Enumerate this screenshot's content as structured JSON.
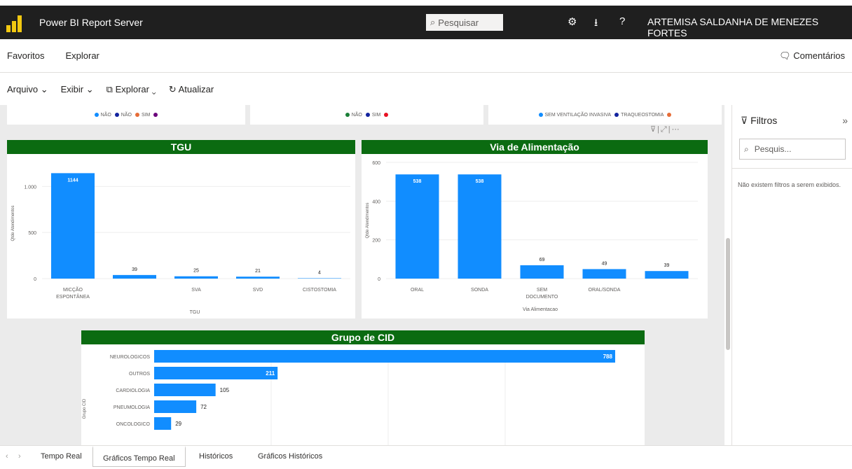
{
  "topbar": {
    "title": "Power BI Report Server",
    "search_placeholder": "Pesquisar",
    "settings_icon": "gear-icon",
    "download_icon": "download-icon",
    "help_label": "?",
    "user": "ARTEMISA SALDANHA DE MENEZES FORTES"
  },
  "menu": {
    "favorites": "Favoritos",
    "explore": "Explorar",
    "comments": "Comentários"
  },
  "toolbar": {
    "file": "Arquivo",
    "view": "Exibir",
    "explore": "Explorar",
    "refresh": "Atualizar"
  },
  "legends": [
    {
      "items": [
        {
          "label": "NÃO",
          "color": "#118dff"
        },
        {
          "label": "NÃO",
          "color": "#12239e"
        },
        {
          "label": "SIM",
          "color": "#e66c37"
        },
        {
          "label": "",
          "color": "#6b007b"
        }
      ]
    },
    {
      "items": [
        {
          "label": "NÃO",
          "color": "#1a7f37"
        },
        {
          "label": "SIM",
          "color": "#12239e"
        },
        {
          "label": "",
          "color": "#e81123"
        }
      ]
    },
    {
      "items": [
        {
          "label": "SEM VENTILAÇÃO INVASIVA",
          "color": "#118dff"
        },
        {
          "label": "TRAQUEOSTOMIA",
          "color": "#12239e"
        },
        {
          "label": "",
          "color": "#e66c37"
        }
      ]
    }
  ],
  "filters": {
    "title": "Filtros",
    "search_placeholder": "Pesquis...",
    "empty_message": "Não existem filtros a serem exibidos."
  },
  "tabs": [
    "Tempo Real",
    "Gráficos Tempo Real",
    "Históricos",
    "Gráficos Históricos"
  ],
  "active_tab": 1,
  "chart_data": [
    {
      "type": "bar",
      "title": "TGU",
      "xlabel": "TGU",
      "ylabel": "Qtde Atendimentos",
      "categories": [
        "MICÇÃO ESPONTÂNEA",
        "",
        "SVA",
        "SVD",
        "CISTOSTOMIA"
      ],
      "values": [
        1144,
        39,
        25,
        21,
        4
      ],
      "ylim": [
        0,
        1200
      ],
      "yticks": [
        "1.000",
        "500",
        "0"
      ],
      "color": "#118dff"
    },
    {
      "type": "bar",
      "title": "Via de Alimentação",
      "xlabel": "Via Alimentacao",
      "ylabel": "Qtde Atendimentos",
      "categories": [
        "ORAL",
        "SONDA",
        "SEM DOCUMENTO",
        "ORAL/SONDA",
        ""
      ],
      "values": [
        538,
        538,
        69,
        49,
        39
      ],
      "ylim": [
        0,
        600
      ],
      "yticks": [
        "600",
        "400",
        "200",
        "0"
      ],
      "color": "#118dff"
    },
    {
      "type": "bar",
      "orientation": "horizontal",
      "title": "Grupo de CID",
      "ylabel": "Grupo CID",
      "categories": [
        "NEUROLOGICOS",
        "OUTROS",
        "CARDIOLOGIA",
        "PNEUMOLOGIA",
        "ONCOLOGICO"
      ],
      "values": [
        788,
        211,
        105,
        72,
        29
      ],
      "xlim": [
        0,
        800
      ],
      "color": "#118dff"
    }
  ]
}
